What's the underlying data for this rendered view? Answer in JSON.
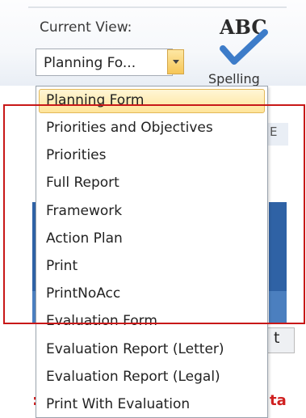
{
  "ribbon": {
    "current_view_label": "Current View:",
    "current_view_value": "Planning Fo...",
    "spelling_icon_text": "ABC",
    "spelling_label": "Spelling"
  },
  "dropdown": {
    "selected_index": 0,
    "items": [
      "Planning Form",
      "Priorities and Objectives",
      "Priorities",
      "Full Report",
      "Framework",
      "Action Plan",
      "Print",
      "PrintNoAcc",
      "Evaluation Form",
      "Evaluation Report (Letter)",
      "Evaluation Report (Legal)",
      "Print With Evaluation"
    ]
  },
  "background": {
    "side_tab_text": "E",
    "t_button_text": "t",
    "red_text_right": "ta",
    "red_text_left": ":"
  },
  "colors": {
    "annotation_red": "#c81818",
    "selection_fill": "#ffe49a",
    "panel_blue": "#2f62a5"
  }
}
